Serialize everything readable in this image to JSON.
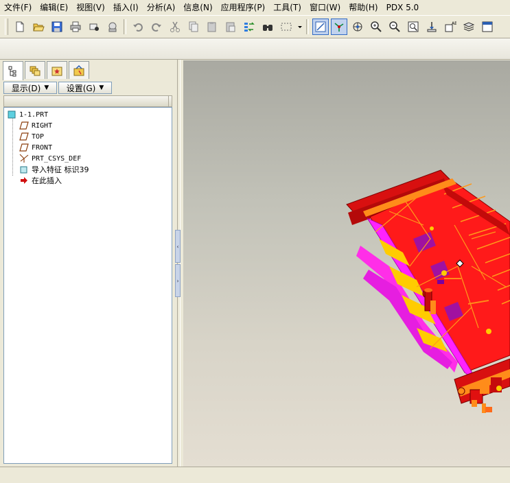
{
  "menu": {
    "items": [
      "文件(F)",
      "编辑(E)",
      "视图(V)",
      "插入(I)",
      "分析(A)",
      "信息(N)",
      "应用程序(P)",
      "工具(T)",
      "窗口(W)",
      "帮助(H)",
      "PDX 5.0"
    ]
  },
  "toolbar": {
    "buttons": [
      "new-file-icon",
      "open-folder-icon",
      "save-icon",
      "print-icon",
      "send-icon",
      "mail-icon",
      "undo-icon",
      "redo-icon",
      "cut-icon",
      "copy-icon",
      "paste-icon",
      "paste-special-icon",
      "regenerate-icon",
      "find-icon",
      "select-box-icon",
      "repaint-icon",
      "spin-center-icon",
      "view-mode-icon",
      "zoom-in-icon",
      "zoom-out-icon",
      "refit-icon",
      "orient-icon",
      "saved-views-icon",
      "layers-icon",
      "window-icon"
    ]
  },
  "model_tree": {
    "display_button": "显示(D)",
    "settings_button": "设置(G)",
    "nodes": {
      "root": "1-1.PRT",
      "right": "RIGHT",
      "top": "TOP",
      "front": "FRONT",
      "csys": "PRT_CSYS_DEF",
      "import": "导入特征 标识39",
      "insert": "在此插入"
    }
  },
  "colors": {
    "part_red": "#ff1a1a",
    "part_magenta": "#ff22ff",
    "part_orange": "#ff8c1a",
    "part_yellow": "#ffcc00",
    "background_top": "#a9a9a1",
    "background_bottom": "#e4ded2"
  }
}
